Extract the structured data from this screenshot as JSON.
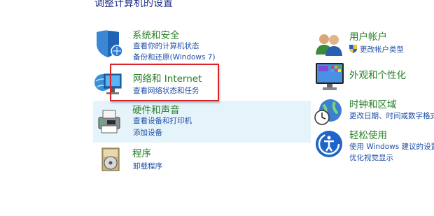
{
  "page_title": "调整计算机的设置",
  "left": [
    {
      "title": "系统和安全",
      "links": [
        "查看你的计算机状态",
        "备份和还原(Windows 7)"
      ],
      "icon": "shield-icon"
    },
    {
      "title": "网络和 Internet",
      "links": [
        "查看网络状态和任务"
      ],
      "icon": "network-icon"
    },
    {
      "title": "硬件和声音",
      "links": [
        "查看设备和打印机",
        "添加设备"
      ],
      "icon": "printer-icon"
    },
    {
      "title": "程序",
      "links": [
        "卸载程序"
      ],
      "icon": "programs-icon"
    }
  ],
  "right": [
    {
      "title": "用户帐户",
      "links": [
        "更改帐户类型"
      ],
      "icon": "users-icon"
    },
    {
      "title": "外观和个性化",
      "links": [],
      "icon": "appearance-icon"
    },
    {
      "title": "时钟和区域",
      "links": [
        "更改日期、时间或数字格式"
      ],
      "icon": "clock-globe-icon"
    },
    {
      "title": "轻松使用",
      "links": [
        "使用 Windows 建议的设置",
        "优化视觉显示"
      ],
      "icon": "ease-of-access-icon"
    }
  ],
  "colors": {
    "title_green": "#267e26",
    "link_blue": "#1f4fa6",
    "highlight_bg": "#e5f3fb",
    "annotation_red": "#d9252a"
  }
}
